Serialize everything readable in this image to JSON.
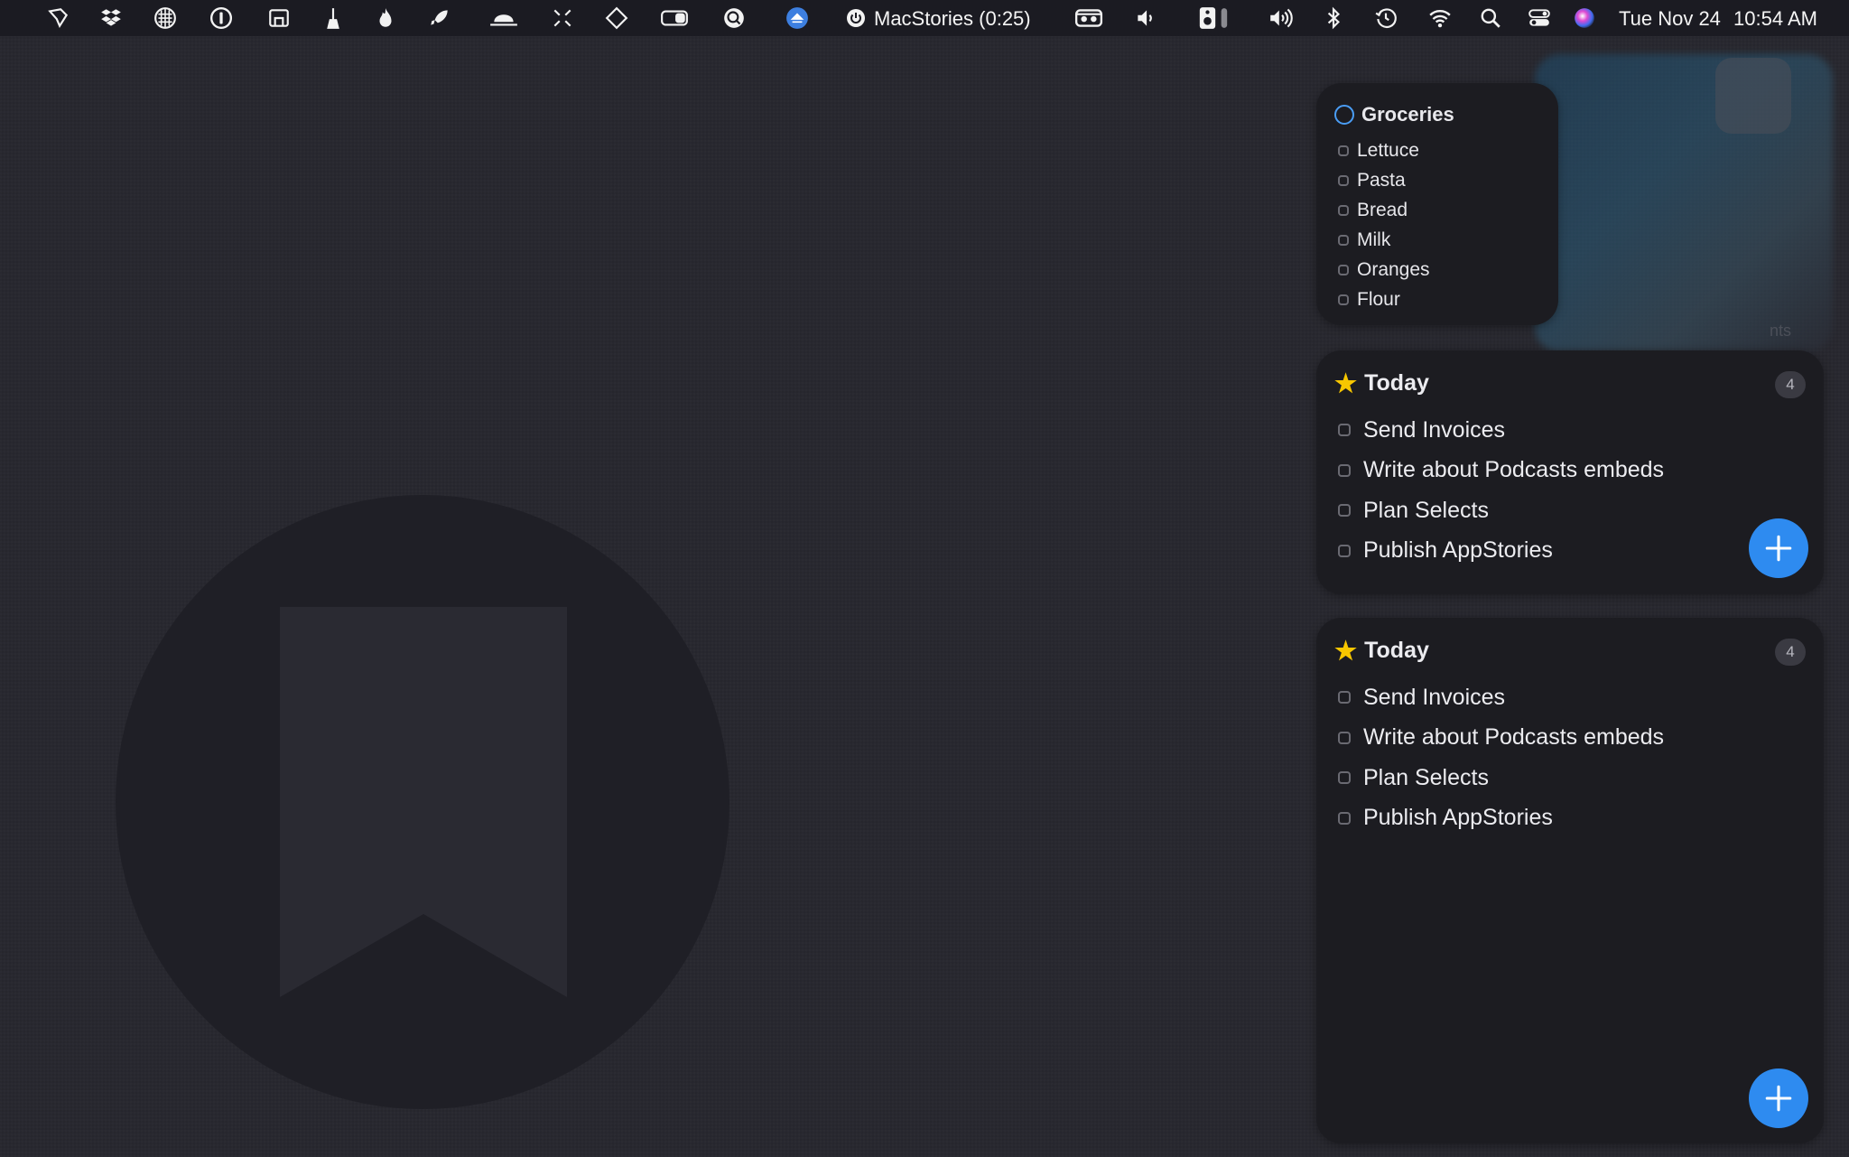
{
  "menubar": {
    "icons": [
      "quill-icon",
      "dropbox-icon",
      "grid-icon",
      "onepassword-icon",
      "screen-icon",
      "broom-icon",
      "flame-icon",
      "rocket-icon",
      "bowler-hat-icon",
      "expand-icon",
      "diamond-icon",
      "toggle-icon",
      "search-app-icon",
      "upload-icon",
      "power-icon",
      "mask-icon",
      "volume-down-icon",
      "speaker-icon",
      "volume-icon",
      "bluetooth-icon",
      "time-machine-icon",
      "wifi-icon",
      "spotlight-icon",
      "control-center-icon",
      "siri-icon"
    ],
    "timer_label": "MacStories (0:25)",
    "date": "Tue Nov 24",
    "time": "10:54 AM"
  },
  "groceries": {
    "title": "Groceries",
    "accent": "#4a9df5",
    "items": [
      "Lettuce",
      "Pasta",
      "Bread",
      "Milk",
      "Oranges",
      "Flour"
    ]
  },
  "today_medium": {
    "title": "Today",
    "count": "4",
    "items": [
      "Send Invoices",
      "Write about Podcasts embeds",
      "Plan Selects",
      "Publish AppStories"
    ]
  },
  "today_large": {
    "title": "Today",
    "count": "4",
    "items": [
      "Send Invoices",
      "Write about Podcasts embeds",
      "Plan Selects",
      "Publish AppStories"
    ]
  },
  "background": {
    "partial_label": "nts"
  },
  "colors": {
    "add_button": "#2e8bf0",
    "star": "#f7c600",
    "widget_bg": "#1c1c21"
  }
}
